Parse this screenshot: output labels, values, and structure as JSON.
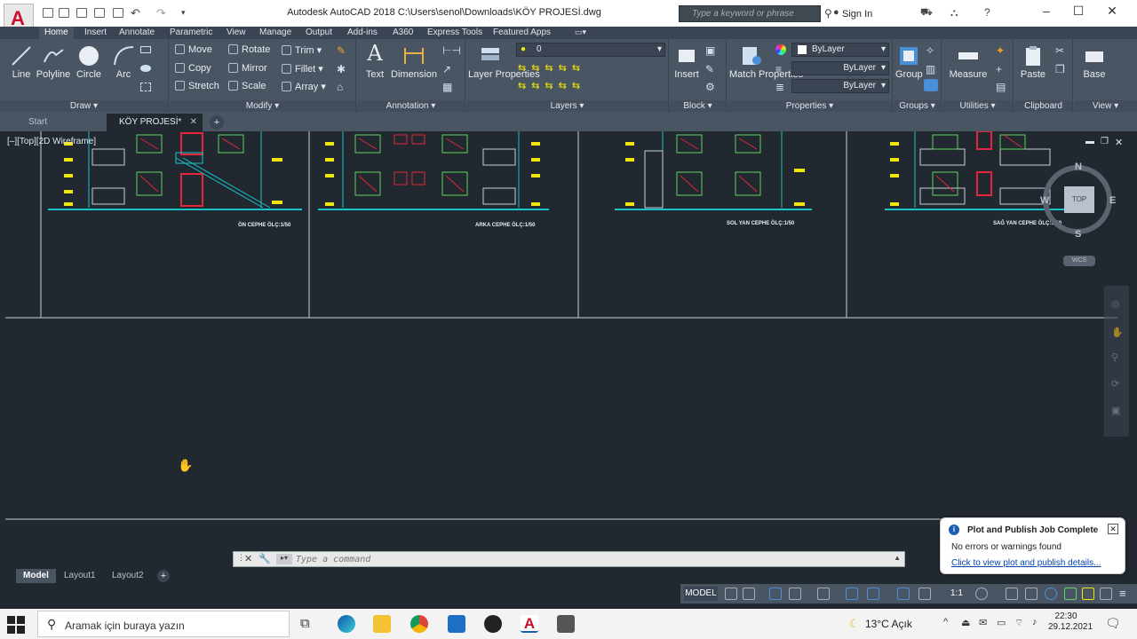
{
  "window": {
    "title": "Autodesk AutoCAD 2018    C:\\Users\\senol\\Downloads\\KÖY PROJESİ.dwg",
    "search_placeholder": "Type a keyword or phrase",
    "sign_in": "Sign In",
    "app_letter": "A"
  },
  "ribbon_tabs": [
    "Home",
    "Insert",
    "Annotate",
    "Parametric",
    "View",
    "Manage",
    "Output",
    "Add-ins",
    "A360",
    "Express Tools",
    "Featured Apps"
  ],
  "ribbon": {
    "draw": {
      "label": "Draw",
      "line": "Line",
      "polyline": "Polyline",
      "circle": "Circle",
      "arc": "Arc"
    },
    "modify": {
      "label": "Modify",
      "move": "Move",
      "rotate": "Rotate",
      "trim": "Trim",
      "copy": "Copy",
      "mirror": "Mirror",
      "fillet": "Fillet",
      "stretch": "Stretch",
      "scale": "Scale",
      "array": "Array"
    },
    "annotation": {
      "label": "Annotation",
      "text": "Text",
      "dimension": "Dimension"
    },
    "layers": {
      "label": "Layers",
      "layer_properties": "Layer Properties",
      "current_layer": "0"
    },
    "block": {
      "label": "Block",
      "insert": "Insert"
    },
    "properties": {
      "label": "Properties",
      "match": "Match Properties",
      "color": "ByLayer",
      "linetype": "ByLayer",
      "lineweight": "ByLayer"
    },
    "groups": {
      "label": "Groups",
      "group": "Group"
    },
    "utilities": {
      "label": "Utilities",
      "measure": "Measure"
    },
    "clipboard": {
      "label": "Clipboard",
      "paste": "Paste"
    },
    "view": {
      "label": "View",
      "base": "Base"
    }
  },
  "doc_tabs": {
    "start": "Start",
    "current": "KÖY PROJESİ*"
  },
  "viewport": {
    "label": "[–][Top][2D Wireframe]",
    "captions": [
      "ÖN CEPHE ÖLÇ:1/50",
      "ARKA CEPHE ÖLÇ:1/50",
      "SOL YAN CEPHE ÖLÇ:1/50",
      "SAĞ YAN CEPHE ÖLÇ:1/50"
    ],
    "compass": {
      "n": "N",
      "s": "S",
      "e": "E",
      "w": "W",
      "top": "TOP",
      "wcs": "WCS"
    }
  },
  "command": {
    "placeholder": "Type a command"
  },
  "layout_tabs": [
    "Model",
    "Layout1",
    "Layout2"
  ],
  "status": {
    "model": "MODEL",
    "scale": "1:1"
  },
  "toast": {
    "title": "Plot and Publish Job Complete",
    "message": "No errors or warnings found",
    "link": "Click to view plot and publish details..."
  },
  "taskbar": {
    "search_placeholder": "Aramak için buraya yazın",
    "weather": "13°C  Açık",
    "time": "22:30",
    "date": "29.12.2021"
  },
  "colors": {
    "accent": "#c8102e",
    "drawing_cyan": "#19c3c8",
    "drawing_yellow": "#f1e60a",
    "drawing_red": "#e3263b",
    "drawing_green": "#5fd35f"
  }
}
